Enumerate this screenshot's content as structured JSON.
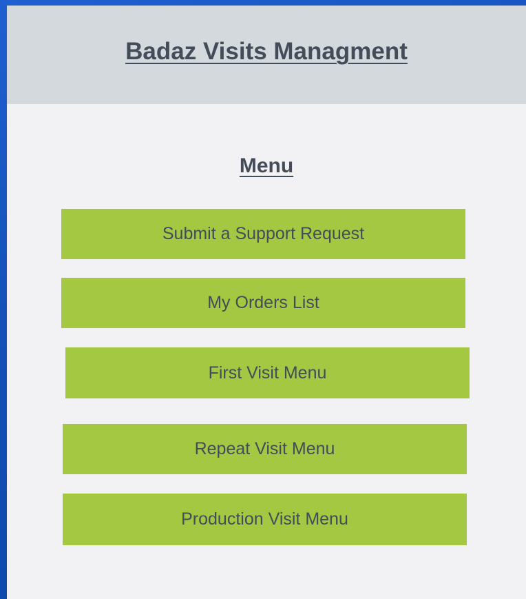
{
  "header": {
    "title": "Badaz Visits Managment"
  },
  "menu": {
    "title": "Menu",
    "items": [
      {
        "label": "Submit a Support Request"
      },
      {
        "label": "My Orders List"
      },
      {
        "label": "First Visit Menu"
      },
      {
        "label": "Repeat Visit Menu"
      },
      {
        "label": "Production Visit Menu"
      }
    ]
  },
  "colors": {
    "background": "#134fb6",
    "panel": "#f2f2f4",
    "header": "#d4d9de",
    "button": "#a4c842",
    "text": "#434c58"
  }
}
